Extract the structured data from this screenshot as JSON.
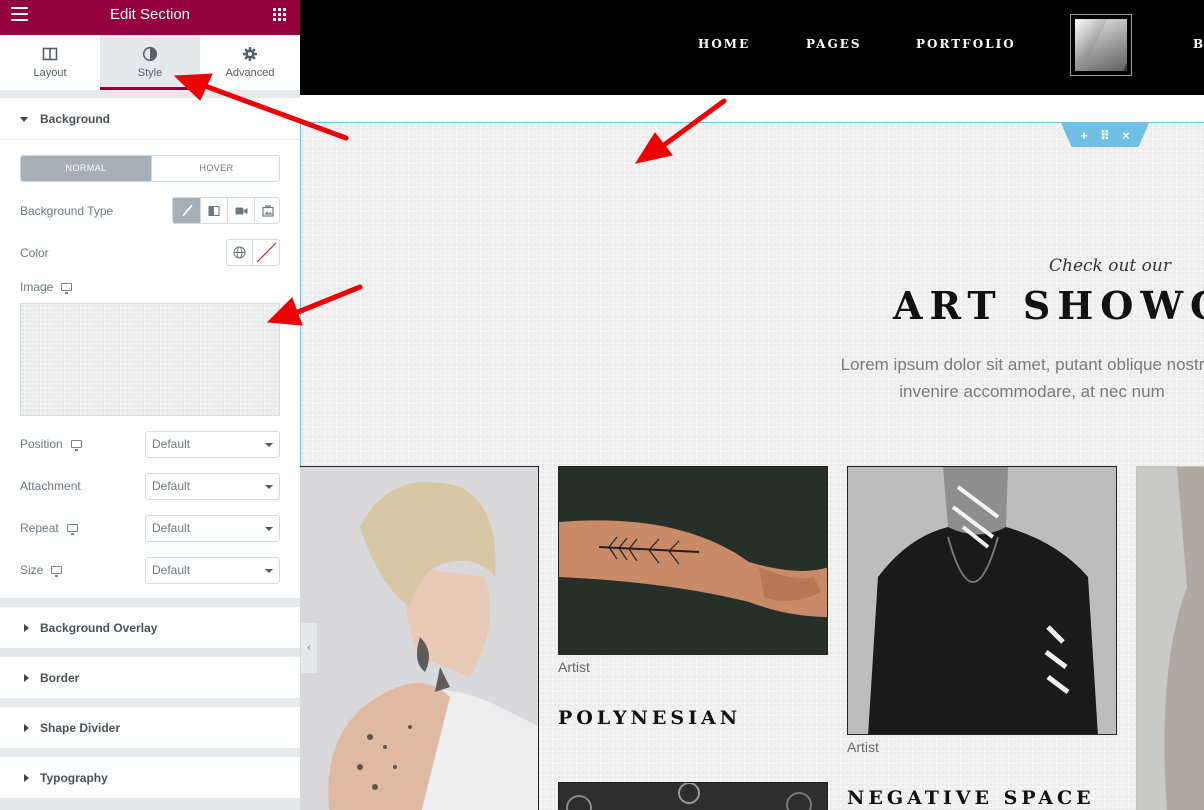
{
  "panel": {
    "title": "Edit Section",
    "tabs": [
      {
        "label": "Layout",
        "icon": "columns-icon",
        "active": false
      },
      {
        "label": "Style",
        "icon": "contrast-icon",
        "active": true
      },
      {
        "label": "Advanced",
        "icon": "gear-icon",
        "active": false
      }
    ],
    "background": {
      "title": "Background",
      "normal_label": "NORMAL",
      "hover_label": "HOVER",
      "type_label": "Background Type",
      "type_options": [
        "classic-brush-icon",
        "gradient-icon",
        "video-icon",
        "slideshow-icon"
      ],
      "color_label": "Color",
      "image_label": "Image",
      "position_label": "Position",
      "position_value": "Default",
      "attachment_label": "Attachment",
      "attachment_value": "Default",
      "repeat_label": "Repeat",
      "repeat_value": "Default",
      "size_label": "Size",
      "size_value": "Default"
    },
    "collapsed_sections": [
      "Background Overlay",
      "Border",
      "Shape Divider",
      "Typography"
    ]
  },
  "site": {
    "nav": [
      "HOME",
      "PAGES",
      "PORTFOLIO",
      "B"
    ],
    "eyebrow": "Check out our",
    "heading": "ART SHOWC",
    "lead_line1": "Lorem ipsum dolor sit amet, putant oblique nostrun",
    "lead_line2": "invenire accommodare, at nec num",
    "cards": [
      {
        "label": "Artist",
        "title": "POLYNESIAN"
      },
      {
        "label": "Artist",
        "title": "NEGATIVE SPACE"
      }
    ]
  },
  "colors": {
    "panel_header": "#93003c",
    "section_outline": "#6ec1e4",
    "arrow": "#ff0000"
  }
}
